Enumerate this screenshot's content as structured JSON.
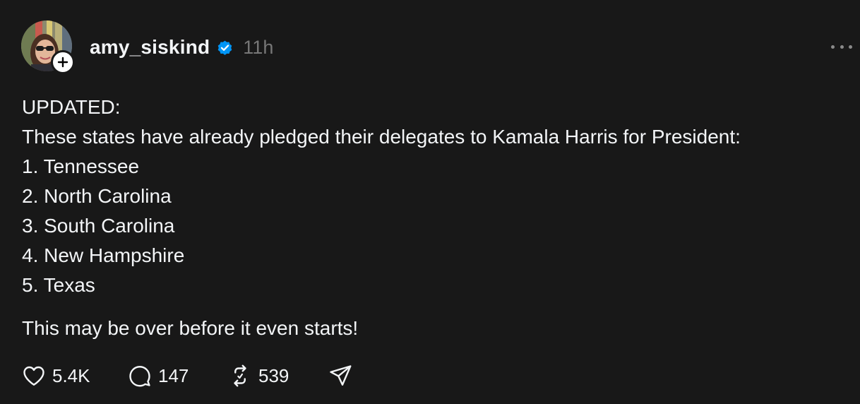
{
  "post": {
    "username": "amy_siskind",
    "timestamp": "11h",
    "verified": true,
    "lines": [
      "UPDATED:",
      "These states have already pledged their delegates to Kamala Harris for President:",
      "1. Tennessee",
      "2. North Carolina",
      "3. South Carolina",
      "4. New Hampshire",
      "5. Texas"
    ],
    "closing": "This may be over before it even starts!",
    "likes": "5.4K",
    "replies": "147",
    "reposts": "539"
  },
  "colors": {
    "background": "#181818",
    "text": "#f3f5f7",
    "muted": "#777777",
    "verified": "#0095f6"
  },
  "icons": {
    "follow": "plus-icon",
    "verified": "verified-badge-icon",
    "more": "more-horizontal-icon",
    "like": "heart-icon",
    "reply": "comment-icon",
    "repost": "repost-icon",
    "share": "send-icon"
  }
}
